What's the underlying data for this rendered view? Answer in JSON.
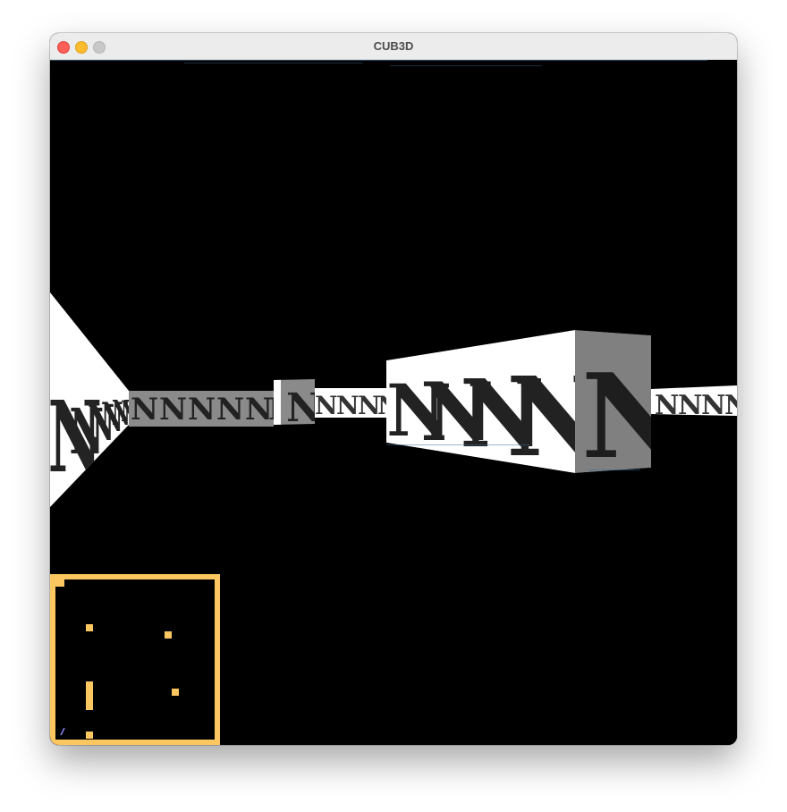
{
  "window": {
    "title": "CUB3D",
    "controls": [
      "close-button",
      "minimize-button",
      "zoom-button"
    ]
  },
  "scene": {
    "ceiling_color": "#000000",
    "floor_color": "#000000",
    "wall_texture_glyph": "N",
    "lit_wall_color": "#ffffff",
    "shaded_wall_color": "#808080",
    "glyph_color": "#222222"
  },
  "minimap": {
    "border_color": "#fcc760",
    "background_color": "#000000",
    "player_color": "#8888ff"
  }
}
